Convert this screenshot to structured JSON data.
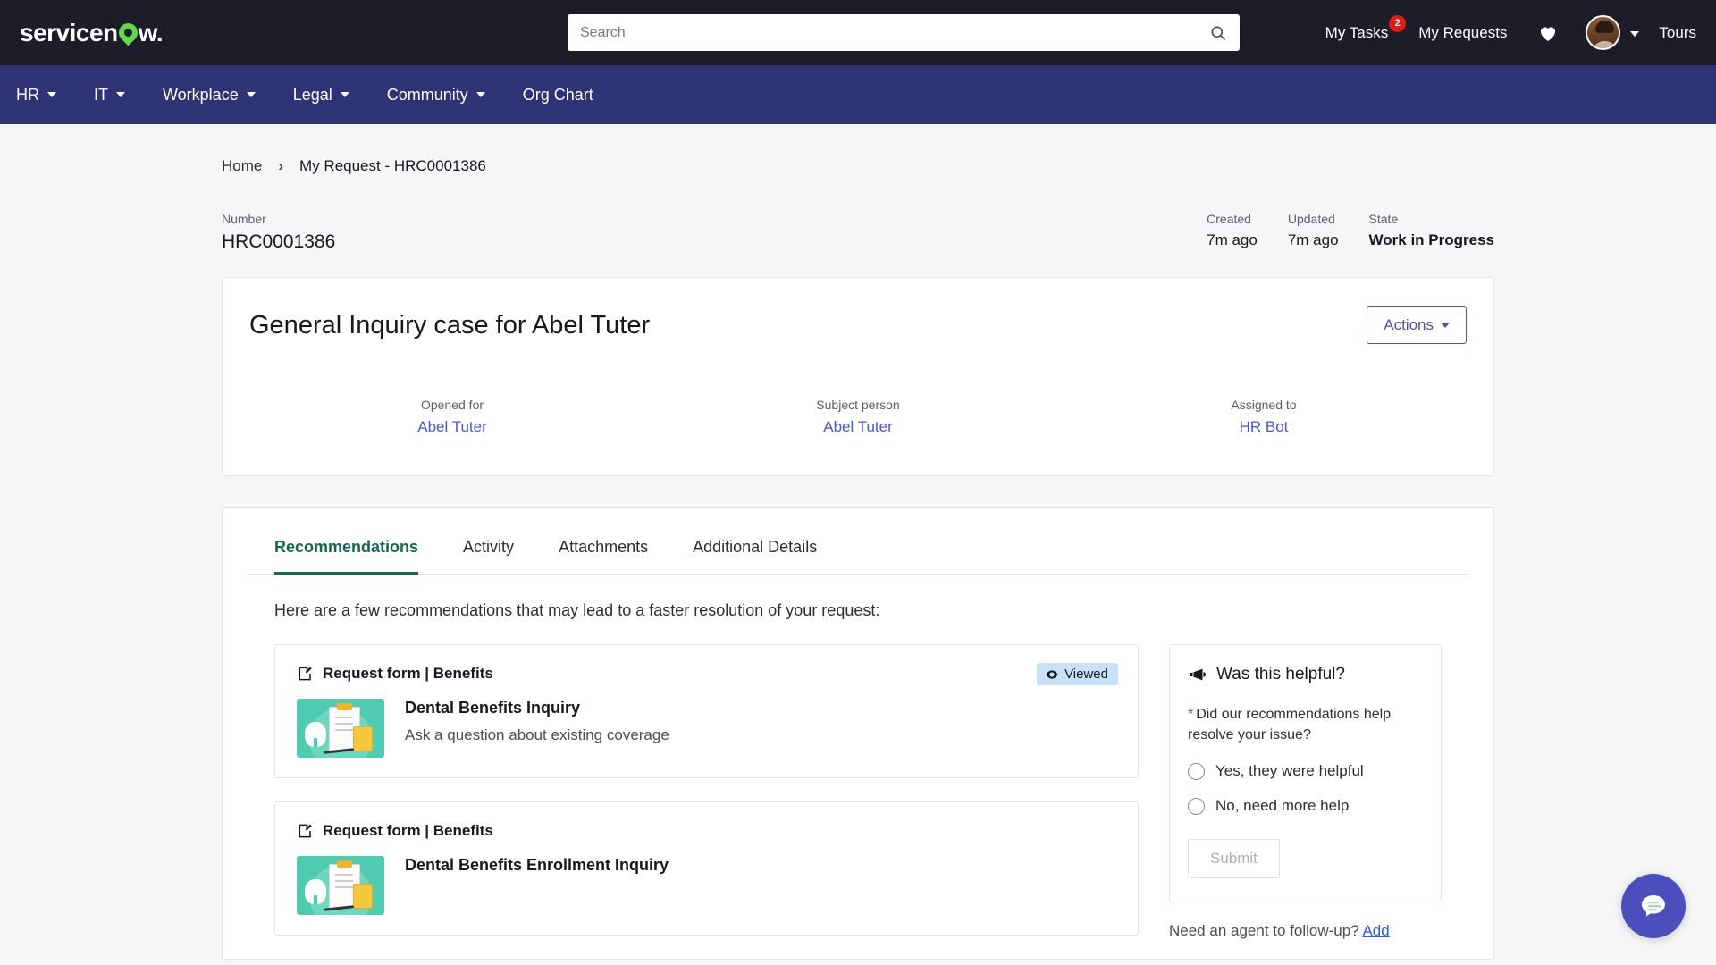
{
  "header": {
    "logo_text": "servicenow",
    "search": {
      "placeholder": "Search",
      "value": ""
    },
    "my_tasks_label": "My Tasks",
    "my_tasks_badge": "2",
    "my_requests_label": "My Requests",
    "tours_label": "Tours",
    "icons": {
      "search": "search-icon",
      "favorites": "heart-icon",
      "profile_menu": "chevron-down-icon"
    },
    "colors": {
      "bar_bg": "#1d1d29",
      "logo_accent": "#62d84e",
      "badge": "#d91e18"
    }
  },
  "nav": {
    "items": [
      {
        "label": "HR",
        "has_caret": true
      },
      {
        "label": "IT",
        "has_caret": true
      },
      {
        "label": "Workplace",
        "has_caret": true
      },
      {
        "label": "Legal",
        "has_caret": true
      },
      {
        "label": "Community",
        "has_caret": true
      },
      {
        "label": "Org Chart",
        "has_caret": false
      }
    ],
    "bg_color": "#2f3275"
  },
  "breadcrumb": {
    "home": "Home",
    "separator": "›",
    "current": "My Request - HRC0001386"
  },
  "meta": {
    "number_label": "Number",
    "number_value": "HRC0001386",
    "created_label": "Created",
    "created_value": "7m ago",
    "updated_label": "Updated",
    "updated_value": "7m ago",
    "state_label": "State",
    "state_value": "Work in Progress"
  },
  "case": {
    "title": "General Inquiry case for Abel Tuter",
    "actions_label": "Actions",
    "people": [
      {
        "label": "Opened for",
        "name": "Abel Tuter"
      },
      {
        "label": "Subject person",
        "name": "Abel Tuter"
      },
      {
        "label": "Assigned to",
        "name": "HR Bot"
      }
    ]
  },
  "tabs": [
    {
      "label": "Recommendations",
      "active": true
    },
    {
      "label": "Activity",
      "active": false
    },
    {
      "label": "Attachments",
      "active": false
    },
    {
      "label": "Additional Details",
      "active": false
    }
  ],
  "recommendations": {
    "intro": "Here are a few recommendations that may lead to a faster resolution of your request:",
    "items": [
      {
        "kicker": "Request form | Benefits",
        "name": "Dental Benefits Inquiry",
        "description": "Ask a question about existing coverage",
        "badge": "Viewed"
      },
      {
        "kicker": "Request form | Benefits",
        "name": "Dental Benefits Enrollment Inquiry",
        "description": "",
        "badge": ""
      }
    ]
  },
  "helpful": {
    "title": "Was this helpful?",
    "question": "Did our recommendations help resolve your issue?",
    "required_marker": "*",
    "option_yes": "Yes, they were helpful",
    "option_no": "No, need more help",
    "submit_label": "Submit",
    "followup_text": "Need an agent to follow-up?",
    "followup_link": "Add"
  },
  "chat": {
    "icon": "chat-bubble-icon",
    "color": "#4b4fbd"
  }
}
